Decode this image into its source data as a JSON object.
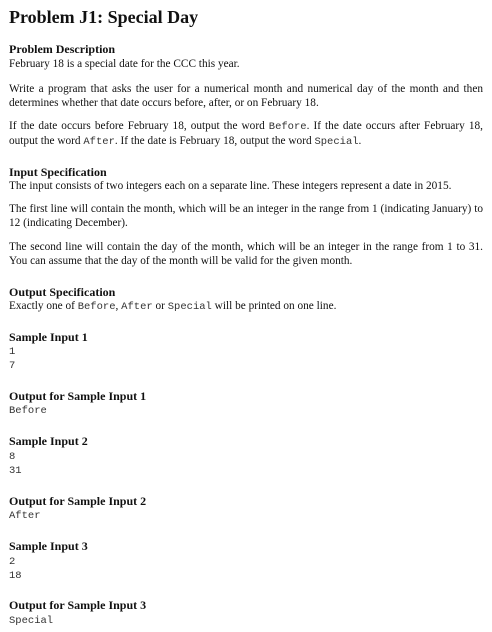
{
  "title": "Problem J1: Special Day",
  "description": {
    "heading": "Problem Description",
    "p1": "February 18 is a special date for the CCC this year.",
    "p2": "Write a program that asks the user for a numerical month and numerical day of the month and then determines whether that date occurs before, after, or on February 18.",
    "p3": {
      "t1": "If the date occurs before February 18, output the word ",
      "c1": "Before",
      "t2": ". If the date occurs after February 18, output the word ",
      "c2": "After",
      "t3": ". If the date is February 18, output the word ",
      "c3": "Special",
      "t4": "."
    }
  },
  "input_spec": {
    "heading": "Input Specification",
    "p1": "The input consists of two integers each on a separate line. These integers represent a date in 2015.",
    "p2": "The first line will contain the month, which will be an integer in the range from 1 (indicating January) to 12 (indicating December).",
    "p3": "The second line will contain the day of the month, which will be an integer in the range from 1 to 31. You can assume that the day of the month will be valid for the given month."
  },
  "output_spec": {
    "heading": "Output Specification",
    "t1": "Exactly one of ",
    "c1": "Before",
    "t2": ", ",
    "c2": "After",
    "t3": " or ",
    "c3": "Special",
    "t4": " will be printed on one line."
  },
  "samples": [
    {
      "input_heading": "Sample Input 1",
      "input_lines": [
        "1",
        "7"
      ],
      "output_heading": "Output for Sample Input 1",
      "output": "Before"
    },
    {
      "input_heading": "Sample Input 2",
      "input_lines": [
        "8",
        "31"
      ],
      "output_heading": "Output for Sample Input 2",
      "output": "After"
    },
    {
      "input_heading": "Sample Input 3",
      "input_lines": [
        "2",
        "18"
      ],
      "output_heading": "Output for Sample Input 3",
      "output": "Special"
    }
  ]
}
